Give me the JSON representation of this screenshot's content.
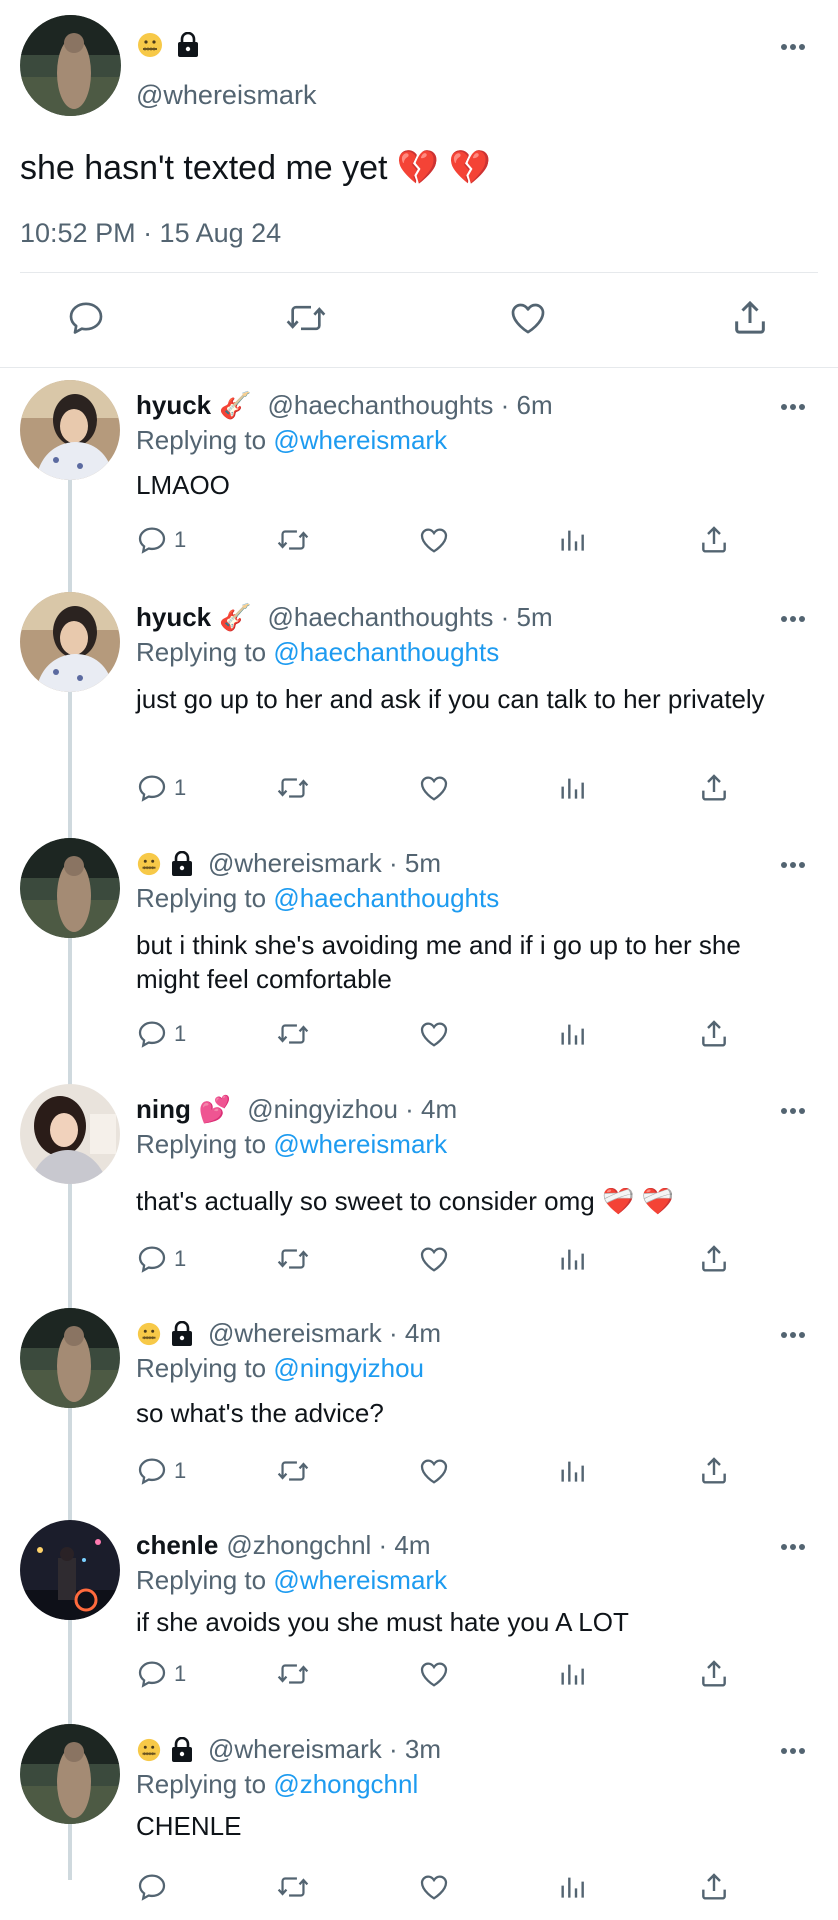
{
  "main_tweet": {
    "handle": "@whereismark",
    "text": "she hasn't texted me yet 💔 💔",
    "timestamp": "10:52 PM · 15 Aug 24"
  },
  "replies": [
    {
      "name": "hyuck",
      "name_emoji": "🎸",
      "handle": "@haechanthoughts · 6m",
      "replying_prefix": "Replying to",
      "replying_to": "@whereismark",
      "text": "LMAOO",
      "reply_count": "1"
    },
    {
      "name": "hyuck",
      "name_emoji": "🎸",
      "handle": "@haechanthoughts · 5m",
      "replying_prefix": "Replying to",
      "replying_to": "@haechanthoughts",
      "text": "just go up to her and ask if you can talk to her privately",
      "reply_count": "1"
    },
    {
      "name": "",
      "name_emoji": "",
      "handle": "@whereismark · 5m",
      "replying_prefix": "Replying to",
      "replying_to": "@haechanthoughts",
      "text": "but i think she's avoiding me and if i go up to her she might feel comfortable",
      "reply_count": "1"
    },
    {
      "name": "ning",
      "name_emoji": "💕",
      "handle": "@ningyizhou · 4m",
      "replying_prefix": "Replying to",
      "replying_to": "@whereismark",
      "text": "that's actually so sweet to consider omg ❤️‍🩹 ❤️‍🩹",
      "reply_count": "1"
    },
    {
      "name": "",
      "name_emoji": "",
      "handle": "@whereismark · 4m",
      "replying_prefix": "Replying to",
      "replying_to": "@ningyizhou",
      "text": "so what's the advice?",
      "reply_count": "1"
    },
    {
      "name": "chenle",
      "name_emoji": "",
      "handle": "@zhongchnl · 4m",
      "replying_prefix": "Replying to",
      "replying_to": "@whereismark",
      "text": "if she avoids you she must hate you A LOT",
      "reply_count": "1"
    },
    {
      "name": "",
      "name_emoji": "",
      "handle": "@whereismark · 3m",
      "replying_prefix": "Replying to",
      "replying_to": "@zhongchnl",
      "text": "CHENLE",
      "reply_count": ""
    }
  ],
  "icons": {
    "reply": "speech-bubble-icon",
    "retweet": "retweet-icon",
    "like": "heart-icon",
    "views": "bar-chart-icon",
    "share": "share-icon",
    "more": "more-dots-icon",
    "lock": "lock-icon",
    "emoji": "zipper-mouth-face-icon"
  },
  "colors": {
    "link": "#1d9bf0",
    "secondary": "#536471",
    "text": "#0f1419",
    "thread_line": "#cfd9de"
  }
}
